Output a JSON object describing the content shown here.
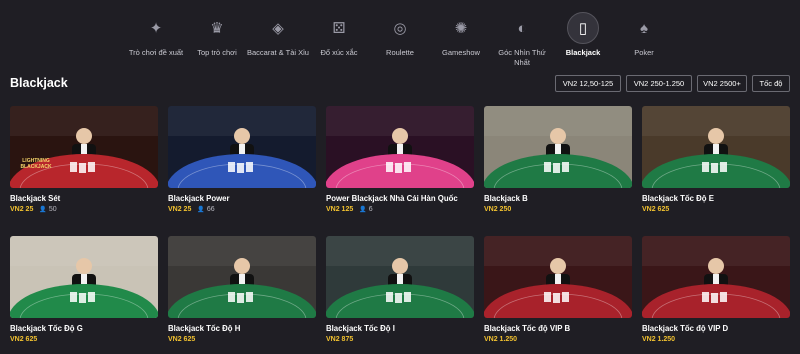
{
  "categories": [
    {
      "label": "Trò chơi đề xuất",
      "icon": "sparkle-dice-icon",
      "active": false
    },
    {
      "label": "Top trò chơi",
      "icon": "trophy-icon",
      "active": false
    },
    {
      "label": "Baccarat & Tài Xỉu",
      "icon": "baccarat-icon",
      "active": false
    },
    {
      "label": "Đổ xúc xắc",
      "icon": "dice-icon",
      "active": false
    },
    {
      "label": "Roulette",
      "icon": "roulette-icon",
      "active": false
    },
    {
      "label": "Gameshow",
      "icon": "gameshow-icon",
      "active": false
    },
    {
      "label": "Góc Nhìn Thứ Nhất",
      "icon": "first-person-icon",
      "active": false
    },
    {
      "label": "Blackjack",
      "icon": "blackjack-cards-icon",
      "active": true
    },
    {
      "label": "Poker",
      "icon": "poker-icon",
      "active": false
    }
  ],
  "section": {
    "title": "Blackjack"
  },
  "filters": [
    "VN2 12,50-125",
    "VN2 250-1.250",
    "VN2 2500+",
    "Tốc độ"
  ],
  "colors": {
    "accent": "#f2c230",
    "background": "#1f1e24"
  },
  "games": [
    {
      "name": "Blackjack Sét",
      "bet": "VN2 25",
      "players": "50",
      "felt": "#b8262c",
      "bg": "#2a1410",
      "logo": "LIGHTNING BLACKJACK"
    },
    {
      "name": "Blackjack Power",
      "bet": "VN2 25",
      "players": "66",
      "felt": "#2f56b8",
      "bg": "#141b2e",
      "logo": ""
    },
    {
      "name": "Power Blackjack Nhà Cái Hàn Quốc",
      "bet": "VN2 125",
      "players": "6",
      "felt": "#e0418a",
      "bg": "#2a1024",
      "logo": ""
    },
    {
      "name": "Blackjack B",
      "bet": "VN2 250",
      "players": "",
      "felt": "#1f7a45",
      "bg": "#8b8679",
      "logo": ""
    },
    {
      "name": "Blackjack Tốc Độ E",
      "bet": "VN2 625",
      "players": "",
      "felt": "#1f7a45",
      "bg": "#4a3a2a",
      "logo": ""
    },
    {
      "name": "Blackjack Tốc Độ G",
      "bet": "VN2 625",
      "players": "",
      "felt": "#218a4a",
      "bg": "#c9c3b6",
      "logo": ""
    },
    {
      "name": "Blackjack Tốc Độ H",
      "bet": "VN2 625",
      "players": "",
      "felt": "#1f7a45",
      "bg": "#3a3836",
      "logo": ""
    },
    {
      "name": "Blackjack Tốc Độ I",
      "bet": "VN2 875",
      "players": "",
      "felt": "#1f7a45",
      "bg": "#2f3a3a",
      "logo": ""
    },
    {
      "name": "Blackjack Tốc độ VIP B",
      "bet": "VN2 1.250",
      "players": "",
      "felt": "#a8222b",
      "bg": "#3a1618",
      "logo": ""
    },
    {
      "name": "Blackjack Tốc độ VIP D",
      "bet": "VN2 1.250",
      "players": "",
      "felt": "#a8222b",
      "bg": "#3a1618",
      "logo": ""
    }
  ]
}
